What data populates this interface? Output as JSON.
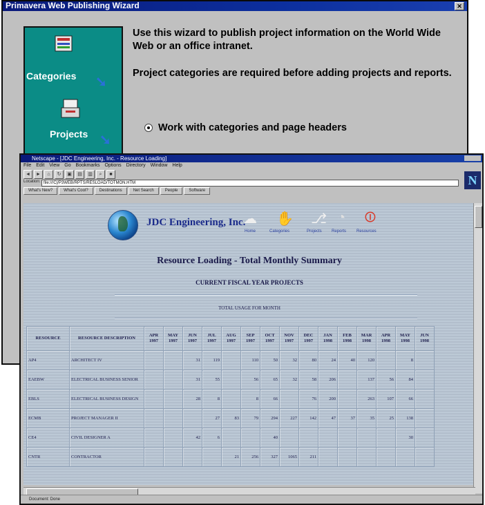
{
  "wizard": {
    "title": "Primavera Web Publishing Wizard",
    "close_glyph": "✕",
    "sidebar": {
      "categories_label": "Categories",
      "projects_label": "Projects"
    },
    "intro_text": "Use this wizard to publish project information on the World Wide Web or an office intranet.",
    "note_text": "Project categories are required before adding projects and reports.",
    "option_text": "Work with categories and page headers"
  },
  "browser": {
    "title": "Netscape - [JDC Engineering, Inc. - Resource Loading]",
    "menu": [
      "File",
      "Edit",
      "View",
      "Go",
      "Bookmarks",
      "Options",
      "Directory",
      "Window",
      "Help"
    ],
    "toolbar_buttons": [
      "Back",
      "Forward",
      "Home",
      "Reload",
      "Images",
      "Open",
      "Print",
      "Find",
      "Stop"
    ],
    "location_label": "Location:",
    "location_value": "file:///C|/P3WEB/RPTS/RESLOAD/TOTMON.HTM",
    "link_buttons": [
      "What's New?",
      "What's Cool?",
      "Destinations",
      "Net Search",
      "People",
      "Software"
    ],
    "logo_letter": "N",
    "status_text": "Document: Done"
  },
  "page": {
    "company": "JDC Engineering, Inc.",
    "nav_items": [
      {
        "label": "Home",
        "icon": "home-icon",
        "glyph": "☁"
      },
      {
        "label": "Categories",
        "icon": "categories-icon",
        "glyph": "✋"
      },
      {
        "label": "Projects",
        "icon": "projects-icon",
        "glyph": "⎇"
      },
      {
        "label": "Reports",
        "icon": "reports-icon",
        "glyph": "◔"
      },
      {
        "label": "Resources",
        "icon": "resources-icon",
        "glyph": "⏼"
      }
    ],
    "title": "Resource Loading - Total Monthly Summary",
    "subtitle": "CURRENT FISCAL YEAR PROJECTS",
    "usage_label": "TOTAL USAGE FOR MONTH"
  },
  "table": {
    "col_resource": "RESOURCE",
    "col_description": "RESOURCE DESCRIPTION",
    "months": [
      "APR 1997",
      "MAY 1997",
      "JUN 1997",
      "JUL 1997",
      "AUG 1997",
      "SEP 1997",
      "OCT 1997",
      "NOV 1997",
      "DEC 1997",
      "JAN 1998",
      "FEB 1998",
      "MAR 1998",
      "APR 1998",
      "MAY 1998",
      "JUN 1998"
    ],
    "rows": [
      {
        "res": "AP4",
        "desc": "ARCHITECT IV",
        "vals": [
          "",
          "",
          "31",
          "119",
          "",
          "110",
          "50",
          "32",
          "80",
          "24",
          "40",
          "120",
          "",
          "8",
          ""
        ]
      },
      {
        "res": "EAEBW",
        "desc": "ELECTRICAL BUSINESS SENIOR",
        "vals": [
          "",
          "",
          "31",
          "55",
          "",
          "56",
          "65",
          "32",
          "58",
          "206",
          "",
          "137",
          "56",
          "84",
          ""
        ]
      },
      {
        "res": "EBLS",
        "desc": "ELECTRICAL BUSINESS DESIGN",
        "vals": [
          "",
          "",
          "28",
          "8",
          "",
          "8",
          "66",
          "",
          "76",
          "200",
          "",
          "263",
          "107",
          "66",
          ""
        ]
      },
      {
        "res": "ECMB",
        "desc": "PROJECT MANAGER II",
        "vals": [
          "",
          "",
          "",
          "27",
          "83",
          "79",
          "294",
          "227",
          "142",
          "47",
          "37",
          "35",
          "25",
          "138",
          ""
        ]
      },
      {
        "res": "CE4",
        "desc": "CIVIL DESIGNER A",
        "vals": [
          "",
          "",
          "42",
          "6",
          "",
          "",
          "40",
          "",
          "",
          "",
          "",
          "",
          "",
          "30",
          ""
        ]
      },
      {
        "res": "CNTR",
        "desc": "CONTRACTOR",
        "vals": [
          "",
          "",
          "",
          "",
          "21",
          "256",
          "327",
          "1065",
          "211",
          "",
          "",
          "",
          "",
          "",
          ""
        ]
      }
    ]
  },
  "colors": {
    "wizard_teal": "#0b8c86",
    "titlebar_blue": "#0c2f9e",
    "page_bg": "#b9c6d4",
    "heading_blue": "#1a2a8a"
  }
}
